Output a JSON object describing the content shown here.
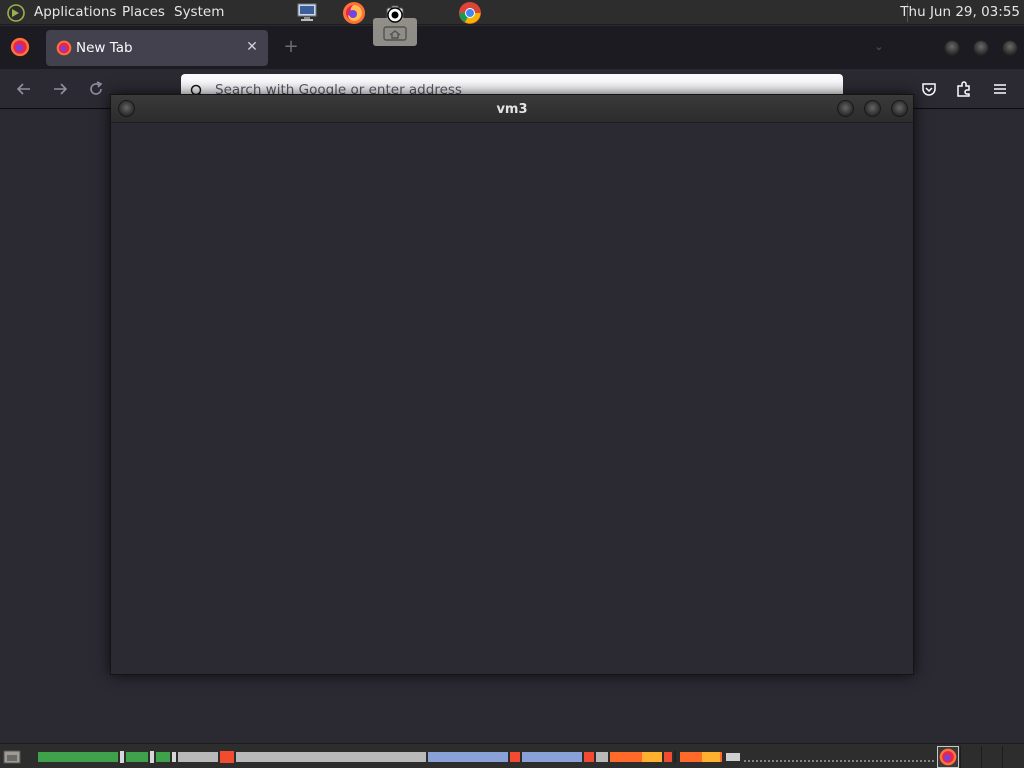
{
  "top_panel": {
    "menus": [
      "Applications",
      "Places",
      "System"
    ],
    "clock": "Thu Jun 29, 03:55"
  },
  "browser": {
    "tab": {
      "title": "New Tab"
    },
    "url_bar": {
      "placeholder": "Search with Google or enter address"
    }
  },
  "vm_window": {
    "title": "vm3"
  },
  "icons": {
    "logo": "distribution-logo-icon",
    "monitor": "monitor-icon",
    "firefox": "firefox-icon",
    "screenshot": "screenshot-icon",
    "chrome": "chrome-icon",
    "back": "arrow-left-icon",
    "forward": "arrow-right-icon",
    "reload": "reload-icon",
    "pocket": "pocket-icon",
    "extensions": "puzzle-icon",
    "menu": "hamburger-icon"
  },
  "colors": {
    "panel": "#2d2d2d",
    "tab_strip": "#1c1b22",
    "active_tab": "#42414d",
    "page_bg": "#2b2a33",
    "url_bar": "#fbfbfe"
  }
}
